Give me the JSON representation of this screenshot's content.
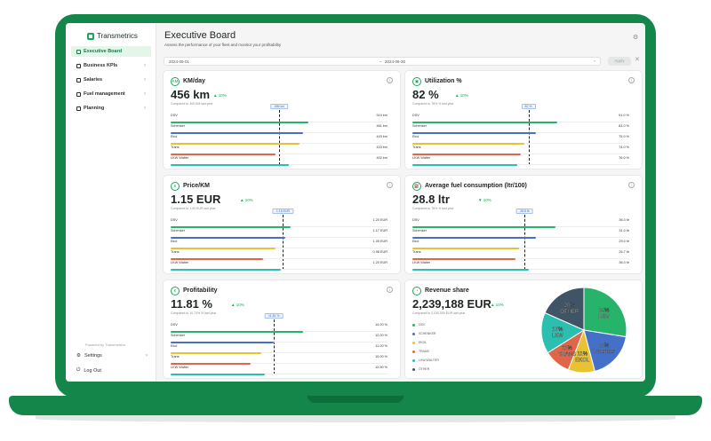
{
  "app": {
    "logo": "Transmetrics"
  },
  "sidebar": {
    "items": [
      {
        "label": "Executive Board",
        "active": true
      },
      {
        "label": "Business KPIs"
      },
      {
        "label": "Salaries"
      },
      {
        "label": "Fuel management"
      },
      {
        "label": "Planning"
      }
    ],
    "powered_by": "Powered by Transmetrics",
    "settings": "Settings",
    "logout": "Log Out"
  },
  "header": {
    "title": "Executive Board",
    "subtitle": "Assess the performance of your fleet and monitor your profitability",
    "date_from": "2024-05-01",
    "date_to": "2024-06-30",
    "apply": "Apply"
  },
  "colors": {
    "green": "#27b36a",
    "blue": "#4570c9",
    "yellow": "#e8c233",
    "red": "#e0664a",
    "teal": "#2bbfb0"
  },
  "carriers": [
    "DSV",
    "Schenker",
    "Ekol",
    "Trans",
    "LKW Walter"
  ],
  "cards": {
    "km": {
      "title": "KM/day",
      "value": "456 km",
      "delta": "▲ 10%",
      "compare": "Compared to 400 KM last year",
      "target": "456 km",
      "target_frac": 0.6,
      "fractions": [
        0.76,
        0.73,
        0.71,
        0.58,
        0.65
      ],
      "values": [
        "510 km",
        "461 km",
        "443 km",
        "423 km",
        "402 km"
      ]
    },
    "util": {
      "title": "Utilization %",
      "value": "82 %",
      "delta": "▲ 10%",
      "compare": "Compared to 78% % last year",
      "target": "82 %",
      "target_frac": 0.64,
      "fractions": [
        0.8,
        0.68,
        0.62,
        0.6,
        0.58
      ],
      "values": [
        "91.0 %",
        "83.0 %",
        "75.0 %",
        "74.0 %",
        "76.0 %"
      ]
    },
    "price": {
      "title": "Price/KM",
      "value": "1.15 EUR",
      "delta": "▲ 10%",
      "compare": "Compared to 1.00 EUR last year",
      "target": "1.15 EUR",
      "target_frac": 0.62,
      "fractions": [
        0.66,
        0.63,
        0.58,
        0.51,
        0.61
      ],
      "values": [
        "1.20 EUR",
        "1.17 EUR",
        "1.05 EUR",
        "0.98 EUR",
        "1.20 EUR"
      ]
    },
    "fuel": {
      "title": "Average fuel consumption (ltr/100)",
      "value": "28.8 ltr",
      "delta": "▼ 10%",
      "compare": "Compared to 78% % last year",
      "target": "28.8 ltr",
      "target_frac": 0.62,
      "fractions": [
        0.79,
        0.68,
        0.59,
        0.57,
        0.64
      ],
      "values": [
        "36.0 ltr",
        "31.0 ltr",
        "29.0 ltr",
        "26.7 ltr",
        "36.0 ltr"
      ]
    },
    "profit": {
      "title": "Profitability",
      "value": "11.81 %",
      "delta": "▲ 10%",
      "compare": "Compared to 10.73% % last year",
      "target": "11.81 %",
      "target_frac": 0.57,
      "fractions": [
        0.73,
        0.57,
        0.5,
        0.44,
        0.52
      ],
      "values": [
        "14.00 %",
        "12.00 %",
        "11.00 %",
        "10.00 %",
        "12.50 %"
      ]
    },
    "revenue": {
      "title": "Revenue share",
      "value": "2,239,188 EUR",
      "delta": "▲ 10%",
      "compare": "Compared to 2,030,000 EUR last year",
      "legend": [
        "DSV",
        "SCHENKER",
        "EKOL",
        "TRANS",
        "LKW WALTER",
        "OTHER"
      ],
      "slices": [
        {
          "label": "30% DSV",
          "value": 30,
          "color": "#27b36a"
        },
        {
          "label": "20% Schenker",
          "value": 20,
          "color": "#4570c9"
        },
        {
          "label": "11% EKOL",
          "value": 11,
          "color": "#e8c233"
        },
        {
          "label": "11% TRANS",
          "value": 11,
          "color": "#e0664a"
        },
        {
          "label": "17% LKW",
          "value": 17,
          "color": "#2bbfb0"
        },
        {
          "label": "20% OTHER",
          "value": 20,
          "color": "#3f5466"
        }
      ]
    }
  }
}
